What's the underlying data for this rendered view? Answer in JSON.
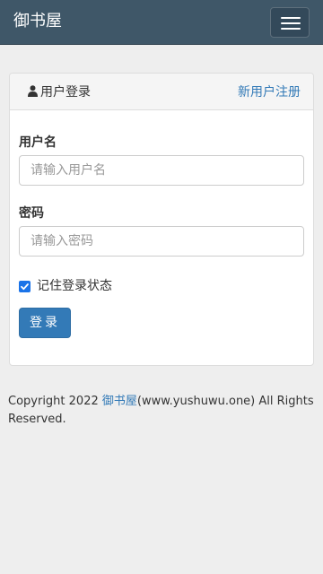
{
  "navbar": {
    "brand": "御书屋",
    "menu_icon": "hamburger-icon"
  },
  "panel": {
    "title": "用户登录",
    "title_icon": "user-icon",
    "register_link": "新用户注册"
  },
  "form": {
    "username_label": "用户名",
    "username_placeholder": "请输入用户名",
    "username_value": "",
    "password_label": "密码",
    "password_placeholder": "请输入密码",
    "password_value": "",
    "remember_label": "记住登录状态",
    "remember_checked": true,
    "submit_label": "登录"
  },
  "footer": {
    "prefix": "Copyright 2022 ",
    "site_link": "御书屋",
    "suffix": "(www.yushuwu.one) All Rights Reserved."
  },
  "colors": {
    "navbar_bg": "#3f5768",
    "link": "#337ab7",
    "button_bg": "#337ab7",
    "page_bg": "#eeeeee"
  }
}
